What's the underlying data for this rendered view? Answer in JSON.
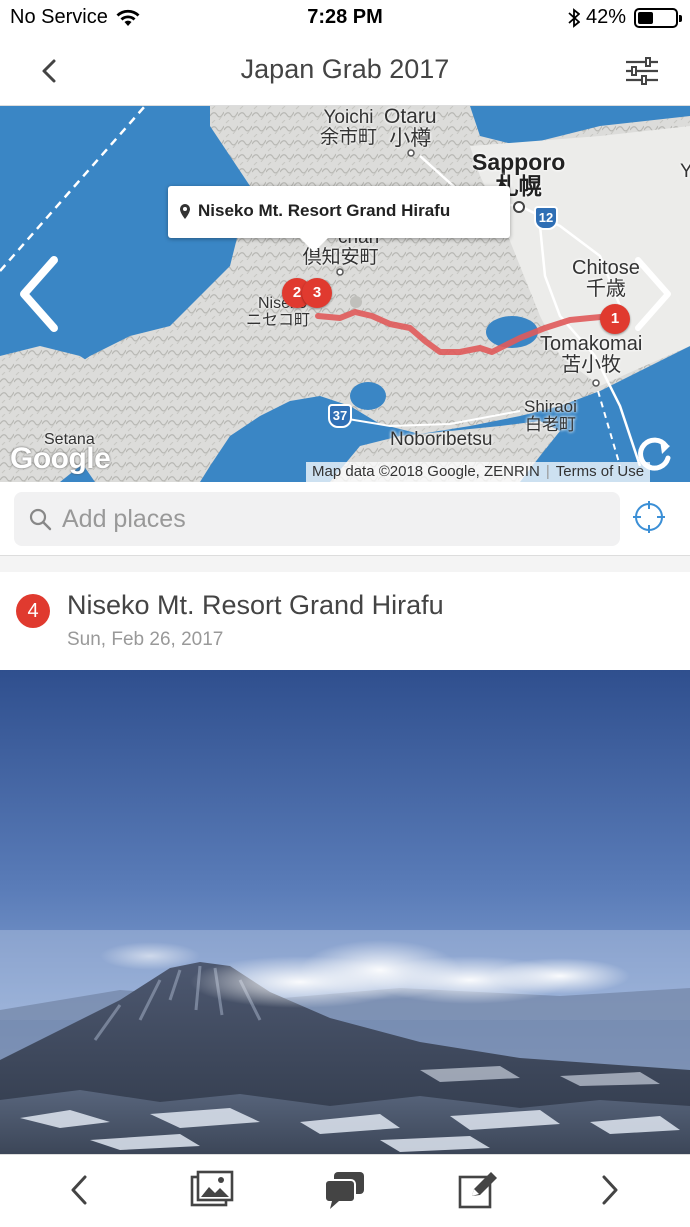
{
  "status": {
    "carrier": "No Service",
    "time": "7:28 PM",
    "battery_text": "42%",
    "battery_level": 0.42
  },
  "nav": {
    "title": "Japan Grab 2017",
    "back_icon": "chevron-left-icon",
    "filter_icon": "sliders-icon"
  },
  "map": {
    "labels": {
      "yoichi": "Yoichi",
      "yoichi_jp": "余市町",
      "otaru": "Otaru",
      "otaru_jp": "小樽",
      "sapporo": "Sapporo",
      "sapporo_jp": "札幌",
      "route12": "12",
      "kutchan_en": "chan",
      "kutchan_jp": "倶知安町",
      "chitose": "Chitose",
      "chitose_jp": "千歳",
      "niseko": "Niseko",
      "niseko_jp": "ニセコ町",
      "tomakomai": "Tomakomai",
      "tomakomai_jp": "苫小牧",
      "shiraoi": "Shiraoi",
      "shiraoi_jp": "白老町",
      "route37": "37",
      "noboribetsu": "Noboribetsu",
      "setana": "Setana",
      "y_edge": "Y"
    },
    "tooltip": "Niseko Mt. Resort Grand Hirafu",
    "markers": {
      "m1": "1",
      "m2": "2",
      "m3": "3"
    },
    "google": "Google",
    "attribution": "Map data ©2018 Google, ZENRIN",
    "terms": "Terms of Use"
  },
  "search": {
    "placeholder": "Add places"
  },
  "place": {
    "number": "4",
    "name": "Niseko Mt. Resort Grand Hirafu",
    "date": "Sun, Feb 26, 2017"
  },
  "toolbar": {
    "icons": [
      "chevron-left-icon",
      "photos-icon",
      "chat-icon",
      "edit-icon",
      "chevron-right-icon"
    ]
  },
  "colors": {
    "accent_red": "#e03a2f",
    "water": "#3a86c5",
    "route": "#e05a5a",
    "locate_blue": "#3b8fd6"
  }
}
